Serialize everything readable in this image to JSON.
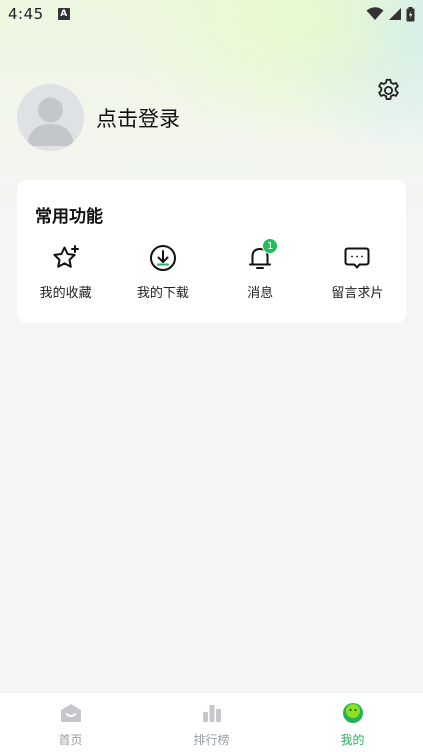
{
  "status_bar": {
    "time": "4:45",
    "notification_glyph": "A"
  },
  "header": {
    "login_text": "点击登录",
    "settings_icon": "gear-icon"
  },
  "functions": {
    "title": "常用功能",
    "items": [
      {
        "label": "我的收藏",
        "icon": "star-plus-icon"
      },
      {
        "label": "我的下载",
        "icon": "download-icon"
      },
      {
        "label": "消息",
        "icon": "bell-icon",
        "badge": "1"
      },
      {
        "label": "留言求片",
        "icon": "chat-bubble-icon"
      }
    ]
  },
  "bottom_nav": {
    "items": [
      {
        "label": "首页",
        "icon": "home-icon"
      },
      {
        "label": "排行榜",
        "icon": "ranking-icon"
      },
      {
        "label": "我的",
        "icon": "profile-face-icon",
        "active": true
      }
    ]
  },
  "colors": {
    "accent": "#22b35a",
    "badge": "#1fbf5c",
    "inactive": "#b8bcc2"
  }
}
